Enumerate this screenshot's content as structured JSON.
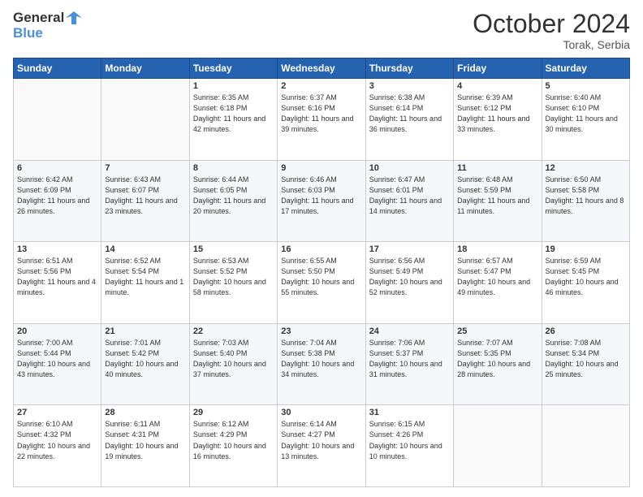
{
  "header": {
    "logo_general": "General",
    "logo_blue": "Blue",
    "month_title": "October 2024",
    "location": "Torak, Serbia"
  },
  "days_of_week": [
    "Sunday",
    "Monday",
    "Tuesday",
    "Wednesday",
    "Thursday",
    "Friday",
    "Saturday"
  ],
  "weeks": [
    [
      {
        "day": "",
        "sunrise": "",
        "sunset": "",
        "daylight": ""
      },
      {
        "day": "",
        "sunrise": "",
        "sunset": "",
        "daylight": ""
      },
      {
        "day": "1",
        "sunrise": "Sunrise: 6:35 AM",
        "sunset": "Sunset: 6:18 PM",
        "daylight": "Daylight: 11 hours and 42 minutes."
      },
      {
        "day": "2",
        "sunrise": "Sunrise: 6:37 AM",
        "sunset": "Sunset: 6:16 PM",
        "daylight": "Daylight: 11 hours and 39 minutes."
      },
      {
        "day": "3",
        "sunrise": "Sunrise: 6:38 AM",
        "sunset": "Sunset: 6:14 PM",
        "daylight": "Daylight: 11 hours and 36 minutes."
      },
      {
        "day": "4",
        "sunrise": "Sunrise: 6:39 AM",
        "sunset": "Sunset: 6:12 PM",
        "daylight": "Daylight: 11 hours and 33 minutes."
      },
      {
        "day": "5",
        "sunrise": "Sunrise: 6:40 AM",
        "sunset": "Sunset: 6:10 PM",
        "daylight": "Daylight: 11 hours and 30 minutes."
      }
    ],
    [
      {
        "day": "6",
        "sunrise": "Sunrise: 6:42 AM",
        "sunset": "Sunset: 6:09 PM",
        "daylight": "Daylight: 11 hours and 26 minutes."
      },
      {
        "day": "7",
        "sunrise": "Sunrise: 6:43 AM",
        "sunset": "Sunset: 6:07 PM",
        "daylight": "Daylight: 11 hours and 23 minutes."
      },
      {
        "day": "8",
        "sunrise": "Sunrise: 6:44 AM",
        "sunset": "Sunset: 6:05 PM",
        "daylight": "Daylight: 11 hours and 20 minutes."
      },
      {
        "day": "9",
        "sunrise": "Sunrise: 6:46 AM",
        "sunset": "Sunset: 6:03 PM",
        "daylight": "Daylight: 11 hours and 17 minutes."
      },
      {
        "day": "10",
        "sunrise": "Sunrise: 6:47 AM",
        "sunset": "Sunset: 6:01 PM",
        "daylight": "Daylight: 11 hours and 14 minutes."
      },
      {
        "day": "11",
        "sunrise": "Sunrise: 6:48 AM",
        "sunset": "Sunset: 5:59 PM",
        "daylight": "Daylight: 11 hours and 11 minutes."
      },
      {
        "day": "12",
        "sunrise": "Sunrise: 6:50 AM",
        "sunset": "Sunset: 5:58 PM",
        "daylight": "Daylight: 11 hours and 8 minutes."
      }
    ],
    [
      {
        "day": "13",
        "sunrise": "Sunrise: 6:51 AM",
        "sunset": "Sunset: 5:56 PM",
        "daylight": "Daylight: 11 hours and 4 minutes."
      },
      {
        "day": "14",
        "sunrise": "Sunrise: 6:52 AM",
        "sunset": "Sunset: 5:54 PM",
        "daylight": "Daylight: 11 hours and 1 minute."
      },
      {
        "day": "15",
        "sunrise": "Sunrise: 6:53 AM",
        "sunset": "Sunset: 5:52 PM",
        "daylight": "Daylight: 10 hours and 58 minutes."
      },
      {
        "day": "16",
        "sunrise": "Sunrise: 6:55 AM",
        "sunset": "Sunset: 5:50 PM",
        "daylight": "Daylight: 10 hours and 55 minutes."
      },
      {
        "day": "17",
        "sunrise": "Sunrise: 6:56 AM",
        "sunset": "Sunset: 5:49 PM",
        "daylight": "Daylight: 10 hours and 52 minutes."
      },
      {
        "day": "18",
        "sunrise": "Sunrise: 6:57 AM",
        "sunset": "Sunset: 5:47 PM",
        "daylight": "Daylight: 10 hours and 49 minutes."
      },
      {
        "day": "19",
        "sunrise": "Sunrise: 6:59 AM",
        "sunset": "Sunset: 5:45 PM",
        "daylight": "Daylight: 10 hours and 46 minutes."
      }
    ],
    [
      {
        "day": "20",
        "sunrise": "Sunrise: 7:00 AM",
        "sunset": "Sunset: 5:44 PM",
        "daylight": "Daylight: 10 hours and 43 minutes."
      },
      {
        "day": "21",
        "sunrise": "Sunrise: 7:01 AM",
        "sunset": "Sunset: 5:42 PM",
        "daylight": "Daylight: 10 hours and 40 minutes."
      },
      {
        "day": "22",
        "sunrise": "Sunrise: 7:03 AM",
        "sunset": "Sunset: 5:40 PM",
        "daylight": "Daylight: 10 hours and 37 minutes."
      },
      {
        "day": "23",
        "sunrise": "Sunrise: 7:04 AM",
        "sunset": "Sunset: 5:38 PM",
        "daylight": "Daylight: 10 hours and 34 minutes."
      },
      {
        "day": "24",
        "sunrise": "Sunrise: 7:06 AM",
        "sunset": "Sunset: 5:37 PM",
        "daylight": "Daylight: 10 hours and 31 minutes."
      },
      {
        "day": "25",
        "sunrise": "Sunrise: 7:07 AM",
        "sunset": "Sunset: 5:35 PM",
        "daylight": "Daylight: 10 hours and 28 minutes."
      },
      {
        "day": "26",
        "sunrise": "Sunrise: 7:08 AM",
        "sunset": "Sunset: 5:34 PM",
        "daylight": "Daylight: 10 hours and 25 minutes."
      }
    ],
    [
      {
        "day": "27",
        "sunrise": "Sunrise: 6:10 AM",
        "sunset": "Sunset: 4:32 PM",
        "daylight": "Daylight: 10 hours and 22 minutes."
      },
      {
        "day": "28",
        "sunrise": "Sunrise: 6:11 AM",
        "sunset": "Sunset: 4:31 PM",
        "daylight": "Daylight: 10 hours and 19 minutes."
      },
      {
        "day": "29",
        "sunrise": "Sunrise: 6:12 AM",
        "sunset": "Sunset: 4:29 PM",
        "daylight": "Daylight: 10 hours and 16 minutes."
      },
      {
        "day": "30",
        "sunrise": "Sunrise: 6:14 AM",
        "sunset": "Sunset: 4:27 PM",
        "daylight": "Daylight: 10 hours and 13 minutes."
      },
      {
        "day": "31",
        "sunrise": "Sunrise: 6:15 AM",
        "sunset": "Sunset: 4:26 PM",
        "daylight": "Daylight: 10 hours and 10 minutes."
      },
      {
        "day": "",
        "sunrise": "",
        "sunset": "",
        "daylight": ""
      },
      {
        "day": "",
        "sunrise": "",
        "sunset": "",
        "daylight": ""
      }
    ]
  ]
}
